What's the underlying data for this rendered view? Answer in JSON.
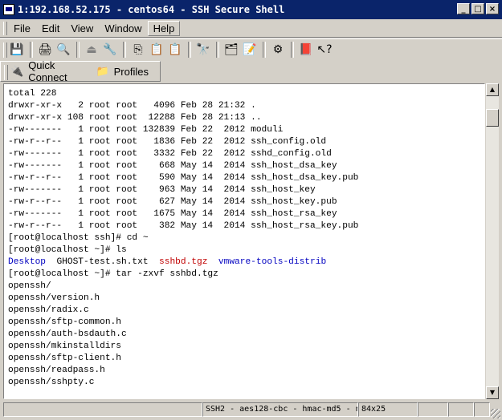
{
  "window": {
    "title": "1:192.168.52.175 - centos64 - SSH Secure Shell",
    "controls": [
      "_",
      "□",
      "×"
    ]
  },
  "menu": {
    "items": [
      "File",
      "Edit",
      "View",
      "Window",
      "Help"
    ]
  },
  "toolbar": {
    "icons": [
      "save-icon",
      "print-icon",
      "print-preview-icon",
      "disconnect-icon",
      "settings-icon",
      "copy-icon",
      "paste-icon",
      "paste-alt-icon",
      "find-icon",
      "profile-icon",
      "profile-edit-icon",
      "sftp-icon",
      "book-icon",
      "help-context-icon"
    ]
  },
  "quickbar": {
    "quick_connect": "Quick Connect",
    "profiles": "Profiles"
  },
  "terminal": {
    "lines": [
      "total 228",
      "drwxr-xr-x   2 root root   4096 Feb 28 21:32 .",
      "drwxr-xr-x 108 root root  12288 Feb 28 21:13 ..",
      "-rw-------   1 root root 132839 Feb 22  2012 moduli",
      "-rw-r--r--   1 root root   1836 Feb 22  2012 ssh_config.old",
      "-rw-------   1 root root   3332 Feb 22  2012 sshd_config.old",
      "-rw-------   1 root root    668 May 14  2014 ssh_host_dsa_key",
      "-rw-r--r--   1 root root    590 May 14  2014 ssh_host_dsa_key.pub",
      "-rw-------   1 root root    963 May 14  2014 ssh_host_key",
      "-rw-r--r--   1 root root    627 May 14  2014 ssh_host_key.pub",
      "-rw-------   1 root root   1675 May 14  2014 ssh_host_rsa_key",
      "-rw-r--r--   1 root root    382 May 14  2014 ssh_host_rsa_key.pub",
      "[root@localhost ssh]# cd ~",
      "[root@localhost ~]# ls"
    ],
    "ls_output": {
      "desktop": "Desktop",
      "ghost": "GHOST-test.sh.txt",
      "sshbd": "sshbd.tgz",
      "vmware": "vmware-tools-distrib",
      "colors": {
        "dir": "#0000c0",
        "archive": "#c00000"
      }
    },
    "lines_after": [
      "[root@localhost ~]# tar -zxvf sshbd.tgz",
      "openssh/",
      "openssh/version.h",
      "openssh/radix.c",
      "openssh/sftp-common.h",
      "openssh/auth-bsdauth.c",
      "openssh/mkinstalldirs",
      "openssh/sftp-client.h",
      "openssh/readpass.h",
      "openssh/sshpty.c"
    ]
  },
  "status": {
    "cipher": "SSH2 - aes128-cbc - hmac-md5 - n",
    "size": "84x25"
  }
}
